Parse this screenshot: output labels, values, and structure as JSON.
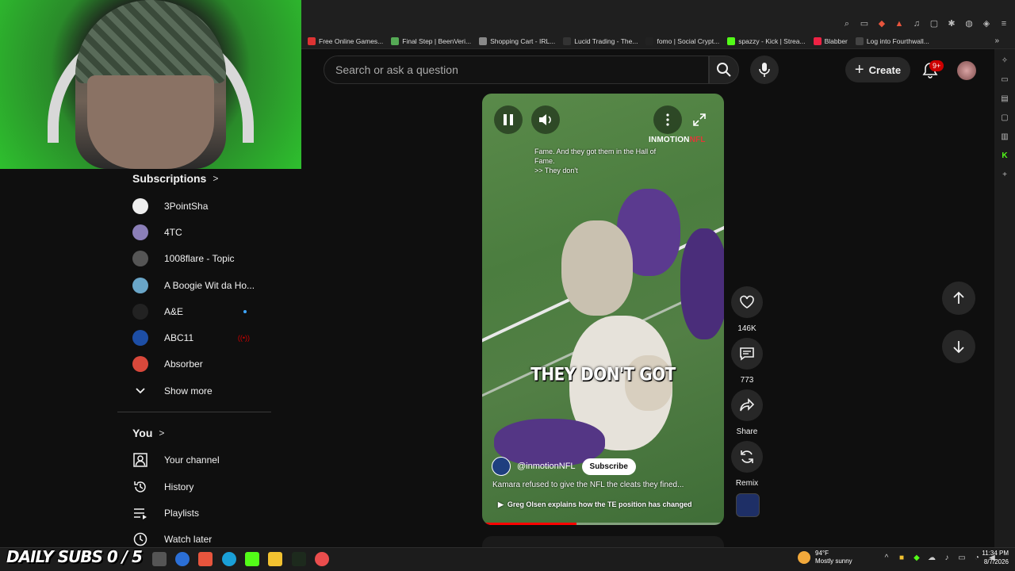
{
  "browser": {
    "bookmarks": [
      {
        "label": "Free Online Games...",
        "color": "#d33"
      },
      {
        "label": "Final Step | BeenVeri...",
        "color": "#5a5"
      },
      {
        "label": "Shopping Cart - IRL...",
        "color": "#888"
      },
      {
        "label": "Lucid Trading - The...",
        "color": "#333"
      },
      {
        "label": "fomo | Social Crypt...",
        "color": "#222"
      },
      {
        "label": "spazzy - Kick | Strea...",
        "color": "#53fc18"
      },
      {
        "label": "Blabber",
        "color": "#e24"
      },
      {
        "label": "Log into Fourthwall...",
        "color": "#444"
      }
    ]
  },
  "header": {
    "search_placeholder": "Search or ask a question",
    "create_label": "Create",
    "notification_badge": "9+"
  },
  "sidebar": {
    "subscriptions_title": "Subscriptions",
    "subscriptions": [
      {
        "label": "3PointSha",
        "color": "#eeeeee"
      },
      {
        "label": "4TC",
        "color": "#8b7fb8"
      },
      {
        "label": "1008flare - Topic",
        "color": "#555555"
      },
      {
        "label": "A Boogie Wit da Ho...",
        "color": "#6aa6c8"
      },
      {
        "label": "A&E",
        "color": "#222222"
      },
      {
        "label": "ABC11",
        "color": "#1d4ea5"
      },
      {
        "label": "Absorber",
        "color": "#d9483b"
      }
    ],
    "show_more": "Show more",
    "you_title": "You",
    "you_items": [
      {
        "label": "Your channel",
        "icon": "person-icon"
      },
      {
        "label": "History",
        "icon": "history-icon"
      },
      {
        "label": "Playlists",
        "icon": "playlists-icon"
      },
      {
        "label": "Watch later",
        "icon": "clock-icon"
      }
    ]
  },
  "short": {
    "brand_a": "INMOTION",
    "brand_b": "NFL",
    "small_caption": "Fame. And they got them in the Hall of Fame.\n>> They don't",
    "big_caption": "THEY DON'T GOT",
    "channel": "@inmotionNFL",
    "subscribe_label": "Subscribe",
    "description": "Kamara refused to give the NFL the cleats they fined...",
    "related": "Greg Olsen explains how the TE position has changed",
    "progress": 0.39
  },
  "actions": {
    "likes": "146K",
    "comments": "773",
    "share": "Share",
    "remix": "Remix"
  },
  "taskbar": {
    "overlay": "DAILY SUBS 0 / 5",
    "temp": "94°F",
    "weather": "Mostly sunny",
    "time": "11:34 PM",
    "date": "8/7/2026"
  }
}
